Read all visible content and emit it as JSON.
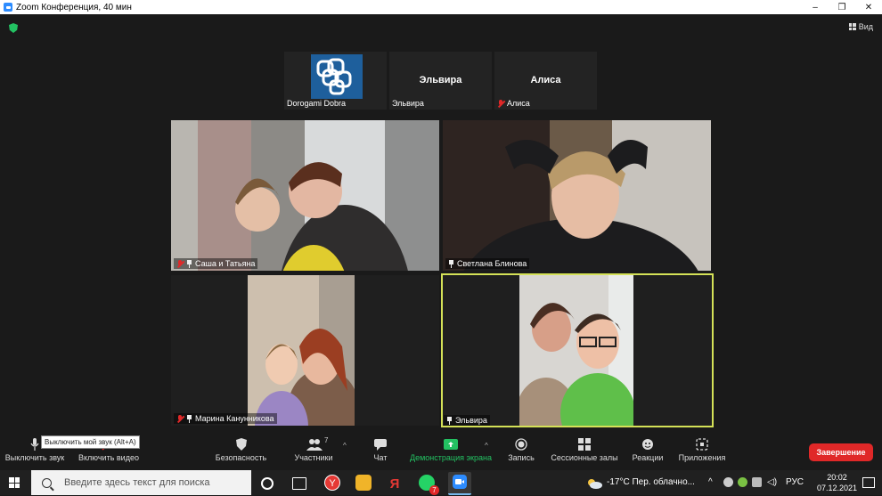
{
  "window": {
    "title": "Zoom Конференция, 40 мин",
    "controls": [
      "–",
      "❐",
      "✕"
    ]
  },
  "view_label": "Вид",
  "thumbnails": [
    {
      "name": "Dorogami Dobra",
      "muted": false
    },
    {
      "name": "Эльвира",
      "center": "Эльвира",
      "muted": false
    },
    {
      "name": "Алиса",
      "center": "Алиса",
      "muted": true
    }
  ],
  "tiles": [
    {
      "name": "Саша и Татьяна",
      "muted": true,
      "pinned": true
    },
    {
      "name": "Светлана Блинова",
      "muted": false,
      "pinned": true
    },
    {
      "name": "Марина Канунникова",
      "muted": true,
      "pinned": true
    },
    {
      "name": "Эльвира",
      "muted": false,
      "pinned": true,
      "active_speaker": true
    }
  ],
  "toolbar": {
    "mute": "Выключить звук",
    "video": "Включить видео",
    "security": "Безопасность",
    "participants": "Участники",
    "participants_count": "7",
    "chat": "Чат",
    "share": "Демонстрация экрана",
    "record": "Запись",
    "rooms": "Сессионные залы",
    "reactions": "Реакции",
    "apps": "Приложения",
    "end": "Завершение",
    "tooltip": "Выключить мой звук (Alt+A)"
  },
  "taskbar": {
    "search_placeholder": "Введите здесь текст для поиска",
    "weather": "-17°C  Пер. облачно...",
    "lang": "РУС",
    "time": "20:02",
    "date": "07.12.2021",
    "whatsapp_badge": "7"
  },
  "colors": {
    "share_green": "#23c162",
    "end_red": "#e02828",
    "active_border": "#d4e157",
    "zoom_blue": "#2d8cff"
  }
}
